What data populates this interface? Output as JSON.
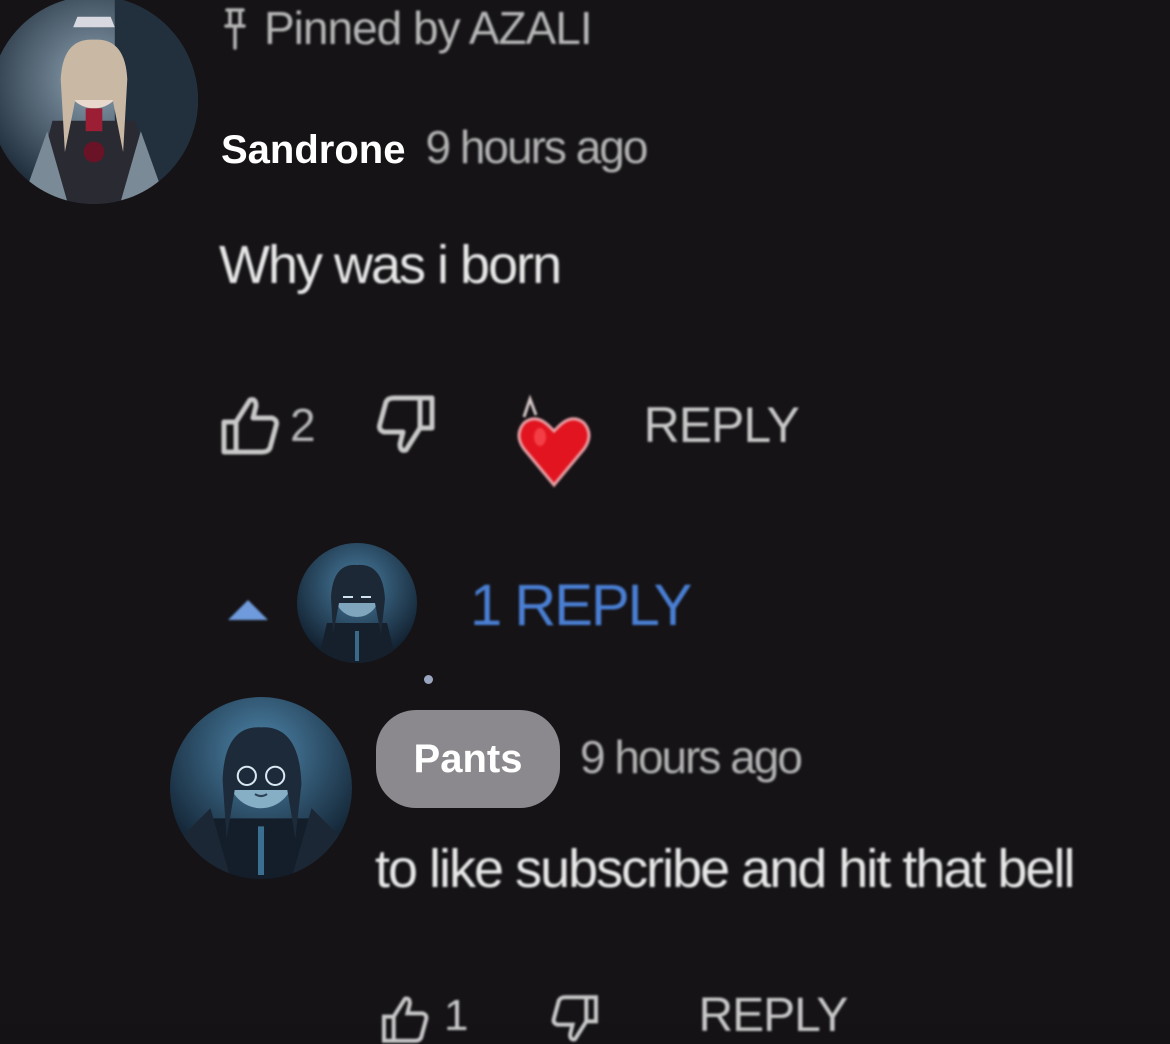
{
  "pinned": {
    "label": "Pinned by AZALI",
    "icon": "pin-icon"
  },
  "comment": {
    "author": "Sandrone",
    "timestamp": "9 hours ago",
    "text": "Why was i born",
    "like_count": "2",
    "reply_label": "REPLY",
    "hearted": true
  },
  "replies_toggle": {
    "label": "1 REPLY",
    "expanded": true,
    "color": "#4a7fd3"
  },
  "reply": {
    "author": "Pants",
    "timestamp": "9 hours ago",
    "text": "to like subscribe and hit that bell",
    "like_count": "1",
    "reply_label": "REPLY"
  },
  "colors": {
    "background": "#151316",
    "heart": "#e2141f",
    "name_chip": "#8b898d"
  }
}
